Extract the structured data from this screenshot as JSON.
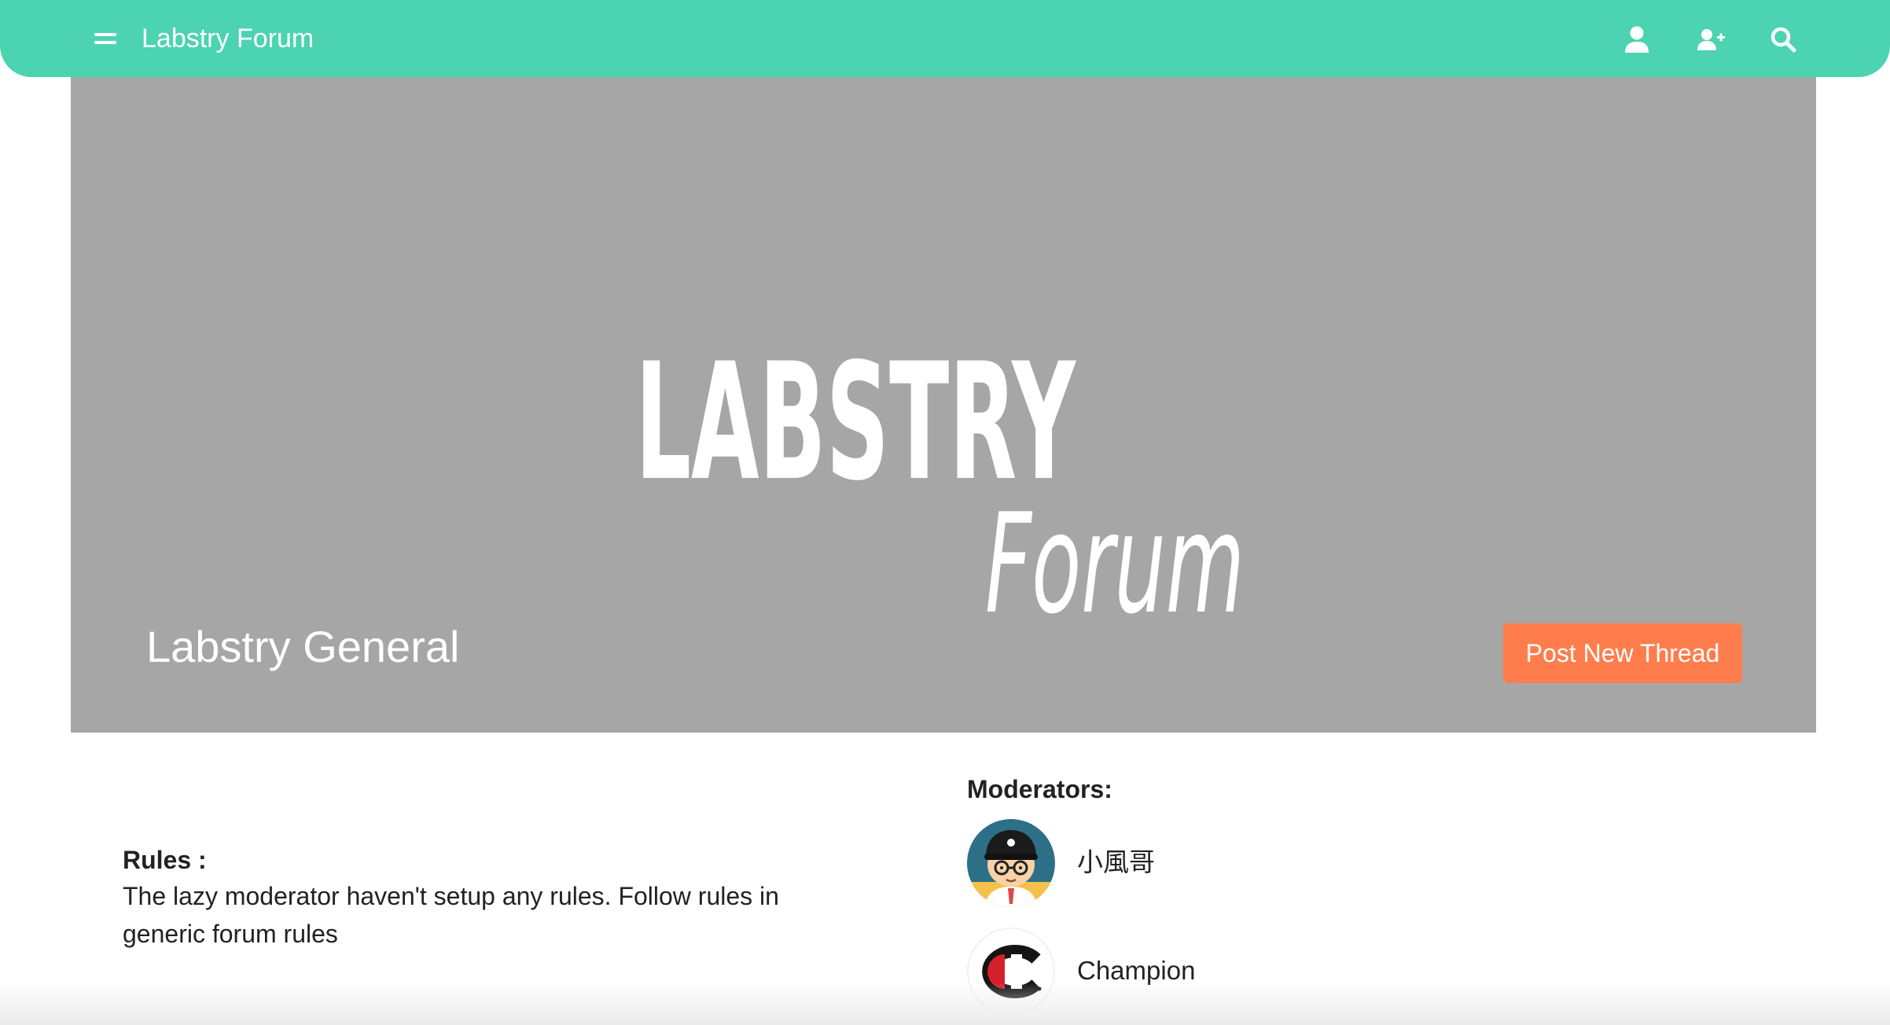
{
  "navbar": {
    "brand": "Labstry Forum",
    "icons": [
      "menu-icon",
      "user-icon",
      "user-plus-icon",
      "search-icon"
    ]
  },
  "banner": {
    "logo_text_top": "LABSTRY",
    "logo_text_bottom": "Forum",
    "forum_title": "Labstry General",
    "post_button_label": "Post New Thread"
  },
  "rules": {
    "heading": "Rules :",
    "text": "The lazy moderator haven't setup any rules. Follow rules in generic forum rules"
  },
  "moderators": {
    "heading": "Moderators:",
    "items": [
      {
        "name": "小風哥",
        "avatar": "cartoon-avatar"
      },
      {
        "name": "Champion",
        "avatar": "champion-logo-avatar"
      }
    ]
  },
  "colors": {
    "navbar": "#4cd3b1",
    "banner": "#a6a6a6",
    "post_button": "#ff7d4d",
    "text": "#222222"
  }
}
